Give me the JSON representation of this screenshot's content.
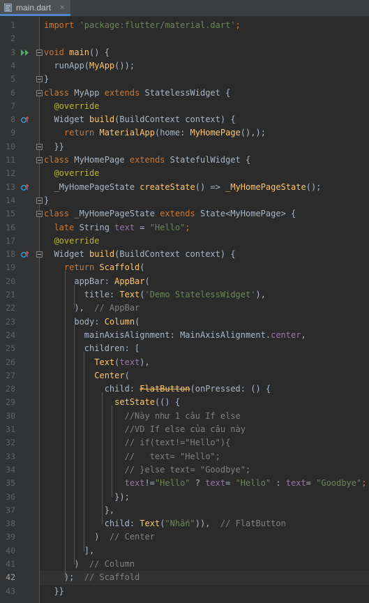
{
  "tab": {
    "filename": "main.dart",
    "close": "×"
  },
  "colors": {
    "background": "#2b2b2b",
    "gutter": "#313335",
    "keyword": "#cc7832",
    "string": "#6a8759",
    "function": "#ffc66d",
    "comment": "#808080",
    "field": "#9876aa",
    "annotation": "#bbb529"
  },
  "current_line": 42,
  "lines": [
    {
      "n": "1",
      "tokens": [
        [
          "import ",
          "kw"
        ],
        [
          "'package:flutter/material.dart'",
          "str"
        ],
        [
          ";",
          "kw"
        ]
      ]
    },
    {
      "n": "2",
      "tokens": []
    },
    {
      "n": "3",
      "tokens": [
        [
          "void ",
          "kw"
        ],
        [
          "main",
          "fn"
        ],
        [
          "() {",
          ""
        ]
      ]
    },
    {
      "n": "4",
      "tokens": [
        [
          "  runApp(",
          ""
        ],
        [
          "MyApp",
          "fn"
        ],
        [
          "());",
          ""
        ]
      ]
    },
    {
      "n": "5",
      "tokens": [
        [
          "}",
          ""
        ]
      ]
    },
    {
      "n": "6",
      "tokens": [
        [
          "class ",
          "kw"
        ],
        [
          "MyApp ",
          ""
        ],
        [
          "extends ",
          "kw"
        ],
        [
          "StatelessWidget {",
          ""
        ]
      ]
    },
    {
      "n": "7",
      "tokens": [
        [
          "  ",
          ""
        ],
        [
          "@override",
          "ann"
        ]
      ]
    },
    {
      "n": "8",
      "tokens": [
        [
          "  Widget ",
          ""
        ],
        [
          "build",
          "fn"
        ],
        [
          "(BuildContext context) {",
          ""
        ]
      ]
    },
    {
      "n": "9",
      "tokens": [
        [
          "    ",
          ""
        ],
        [
          "return ",
          "kw"
        ],
        [
          "MaterialApp",
          "fn"
        ],
        [
          "(home: ",
          ""
        ],
        [
          "MyHomePage",
          "fn"
        ],
        [
          "(),);",
          ""
        ]
      ]
    },
    {
      "n": "10",
      "tokens": [
        [
          "  }}",
          ""
        ]
      ]
    },
    {
      "n": "11",
      "tokens": [
        [
          "class ",
          "kw"
        ],
        [
          "MyHomePage ",
          ""
        ],
        [
          "extends ",
          "kw"
        ],
        [
          "StatefulWidget {",
          ""
        ]
      ]
    },
    {
      "n": "12",
      "tokens": [
        [
          "  ",
          ""
        ],
        [
          "@override",
          "ann"
        ]
      ]
    },
    {
      "n": "13",
      "tokens": [
        [
          "  _MyHomePageState ",
          ""
        ],
        [
          "createState",
          "fn"
        ],
        [
          "() => ",
          ""
        ],
        [
          "_MyHomePageState",
          "fn"
        ],
        [
          "();",
          ""
        ]
      ]
    },
    {
      "n": "14",
      "tokens": [
        [
          "}",
          ""
        ]
      ]
    },
    {
      "n": "15",
      "tokens": [
        [
          "class ",
          "kw"
        ],
        [
          "_MyHomePageState ",
          ""
        ],
        [
          "extends ",
          "kw"
        ],
        [
          "State<MyHomePage> {",
          ""
        ]
      ]
    },
    {
      "n": "16",
      "tokens": [
        [
          "  ",
          ""
        ],
        [
          "late ",
          "kw"
        ],
        [
          "String ",
          ""
        ],
        [
          "text",
          "fld"
        ],
        [
          " = ",
          ""
        ],
        [
          "\"Hello\"",
          "str"
        ],
        [
          ";",
          "kw"
        ]
      ]
    },
    {
      "n": "17",
      "tokens": [
        [
          "  ",
          ""
        ],
        [
          "@override",
          "ann"
        ]
      ]
    },
    {
      "n": "18",
      "tokens": [
        [
          "  Widget ",
          ""
        ],
        [
          "build",
          "fn"
        ],
        [
          "(BuildContext context) {",
          ""
        ]
      ]
    },
    {
      "n": "19",
      "tokens": [
        [
          "    ",
          ""
        ],
        [
          "return ",
          "kw"
        ],
        [
          "Scaffold",
          "fn"
        ],
        [
          "(",
          ""
        ]
      ]
    },
    {
      "n": "20",
      "tokens": [
        [
          "      appBar: ",
          ""
        ],
        [
          "AppBar",
          "fn"
        ],
        [
          "(",
          ""
        ]
      ]
    },
    {
      "n": "21",
      "tokens": [
        [
          "        title: ",
          ""
        ],
        [
          "Text",
          "fn"
        ],
        [
          "(",
          ""
        ],
        [
          "'Demo StatelessWidget'",
          "str"
        ],
        [
          "),",
          ""
        ]
      ]
    },
    {
      "n": "22",
      "tokens": [
        [
          "      ),  ",
          ""
        ],
        [
          "// AppBar",
          "cm"
        ]
      ]
    },
    {
      "n": "23",
      "tokens": [
        [
          "      body: ",
          ""
        ],
        [
          "Column",
          "fn"
        ],
        [
          "(",
          ""
        ]
      ]
    },
    {
      "n": "24",
      "tokens": [
        [
          "        mainAxisAlignment: MainAxisAlignment.",
          ""
        ],
        [
          "center",
          "fld"
        ],
        [
          ",",
          ""
        ]
      ]
    },
    {
      "n": "25",
      "tokens": [
        [
          "        children: [",
          ""
        ]
      ]
    },
    {
      "n": "26",
      "tokens": [
        [
          "          ",
          ""
        ],
        [
          "Text",
          "fn"
        ],
        [
          "(",
          ""
        ],
        [
          "text",
          "fld"
        ],
        [
          "),",
          ""
        ]
      ]
    },
    {
      "n": "27",
      "tokens": [
        [
          "          ",
          ""
        ],
        [
          "Center",
          "fn"
        ],
        [
          "(",
          ""
        ]
      ]
    },
    {
      "n": "28",
      "tokens": [
        [
          "            child: ",
          ""
        ],
        [
          "FlatButton",
          "fn dep"
        ],
        [
          "(onPressed: () {",
          ""
        ]
      ]
    },
    {
      "n": "29",
      "tokens": [
        [
          "              ",
          ""
        ],
        [
          "setState",
          "fn"
        ],
        [
          "(() {",
          ""
        ]
      ]
    },
    {
      "n": "30",
      "tokens": [
        [
          "                ",
          ""
        ],
        [
          "//Này như 1 câu If else",
          "cm"
        ]
      ]
    },
    {
      "n": "31",
      "tokens": [
        [
          "                ",
          ""
        ],
        [
          "//VD If else của câu này",
          "cm"
        ]
      ]
    },
    {
      "n": "32",
      "tokens": [
        [
          "                ",
          ""
        ],
        [
          "// if(text!=\"Hello\"){",
          "cm"
        ]
      ]
    },
    {
      "n": "33",
      "tokens": [
        [
          "                ",
          ""
        ],
        [
          "//   text= \"Hello\";",
          "cm"
        ]
      ]
    },
    {
      "n": "34",
      "tokens": [
        [
          "                ",
          ""
        ],
        [
          "// }else text= \"Goodbye\";",
          "cm"
        ]
      ]
    },
    {
      "n": "35",
      "tokens": [
        [
          "                ",
          ""
        ],
        [
          "text",
          "fld"
        ],
        [
          "!=",
          ""
        ],
        [
          "\"Hello\"",
          "str"
        ],
        [
          " ? ",
          ""
        ],
        [
          "text",
          "fld"
        ],
        [
          "= ",
          ""
        ],
        [
          "\"Hello\"",
          "str"
        ],
        [
          " : ",
          ""
        ],
        [
          "text",
          "fld"
        ],
        [
          "= ",
          ""
        ],
        [
          "\"Goodbye\"",
          "str"
        ],
        [
          ";",
          "kw"
        ]
      ]
    },
    {
      "n": "36",
      "tokens": [
        [
          "              });",
          ""
        ]
      ]
    },
    {
      "n": "37",
      "tokens": [
        [
          "            },",
          ""
        ]
      ]
    },
    {
      "n": "38",
      "tokens": [
        [
          "            child: ",
          ""
        ],
        [
          "Text",
          "fn"
        ],
        [
          "(",
          ""
        ],
        [
          "\"Nhấn\"",
          "str"
        ],
        [
          ")),  ",
          ""
        ],
        [
          "// FlatButton",
          "cm"
        ]
      ]
    },
    {
      "n": "39",
      "tokens": [
        [
          "          )  ",
          ""
        ],
        [
          "// Center",
          "cm"
        ]
      ]
    },
    {
      "n": "40",
      "tokens": [
        [
          "        ],",
          ""
        ]
      ]
    },
    {
      "n": "41",
      "tokens": [
        [
          "      )  ",
          ""
        ],
        [
          "// Column",
          "cm"
        ]
      ]
    },
    {
      "n": "42",
      "tokens": [
        [
          "    );  ",
          ""
        ],
        [
          "// Scaffold",
          "cm"
        ]
      ]
    },
    {
      "n": "43",
      "tokens": [
        [
          "  }}",
          ""
        ]
      ]
    }
  ],
  "gutter_markers": [
    {
      "line": 3,
      "icon": "run-icon"
    },
    {
      "line": 8,
      "icon": "override-method-icon"
    },
    {
      "line": 13,
      "icon": "override-method-icon"
    },
    {
      "line": 18,
      "icon": "override-method-icon"
    }
  ]
}
